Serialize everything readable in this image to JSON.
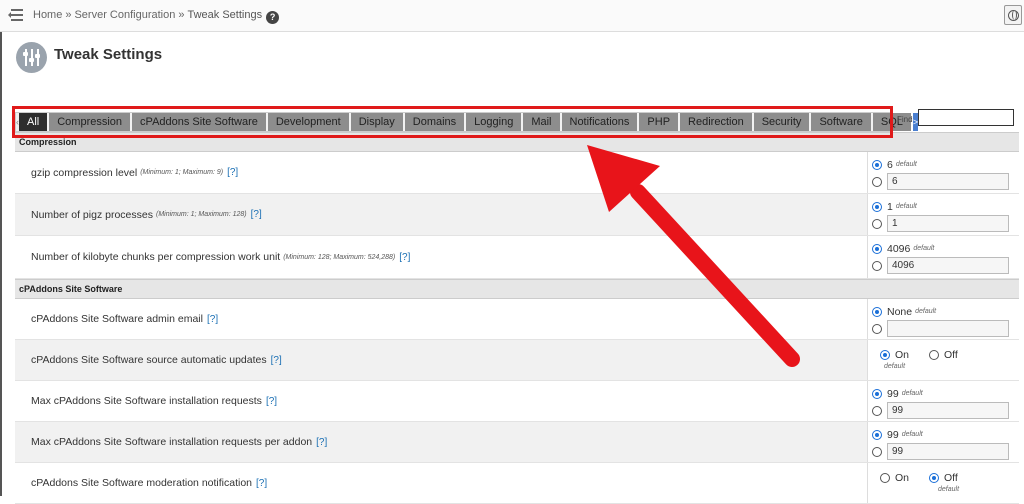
{
  "breadcrumb": {
    "home": "Home",
    "sep": "»",
    "section": "Server Configuration",
    "current": "Tweak Settings",
    "help": "?"
  },
  "page": {
    "title": "Tweak Settings"
  },
  "tabs": {
    "items": [
      "All",
      "Compression",
      "cPAddons Site Software",
      "Development",
      "Display",
      "Domains",
      "Logging",
      "Mail",
      "Notifications",
      "PHP",
      "Redirection",
      "Security",
      "Software",
      "SQL"
    ],
    "active": "All",
    "prev": "‹",
    "next": ">"
  },
  "find": {
    "label": "Find",
    "value": ""
  },
  "sections": [
    {
      "title": "Compression",
      "rows": [
        {
          "label": "gzip compression level",
          "hint": "(Minimum: 1; Maximum: 9)",
          "help": "[?]",
          "default_value": "6",
          "default_tag": "default",
          "input_value": "6"
        },
        {
          "label": "Number of pigz processes",
          "hint": "(Minimum: 1; Maximum: 128)",
          "help": "[?]",
          "default_value": "1",
          "default_tag": "default",
          "input_value": "1"
        },
        {
          "label": "Number of kilobyte chunks per compression work unit",
          "hint": "(Minimum: 128; Maximum: 524,288)",
          "help": "[?]",
          "default_value": "4096",
          "default_tag": "default",
          "input_value": "4096"
        }
      ]
    },
    {
      "title": "cPAddons Site Software",
      "rows": [
        {
          "label": "cPAddons Site Software admin email",
          "hint": "",
          "help": "[?]",
          "default_value": "None",
          "default_tag": "default",
          "input_value": ""
        },
        {
          "label": "cPAddons Site Software source automatic updates",
          "hint": "",
          "help": "[?]",
          "on": "On",
          "off": "Off",
          "selected": "on",
          "default_tag": "default"
        },
        {
          "label": "Max cPAddons Site Software installation requests",
          "hint": "",
          "help": "[?]",
          "default_value": "99",
          "default_tag": "default",
          "input_value": "99"
        },
        {
          "label": "Max cPAddons Site Software installation requests per addon",
          "hint": "",
          "help": "[?]",
          "default_value": "99",
          "default_tag": "default",
          "input_value": "99"
        },
        {
          "label": "cPAddons Site Software moderation notification",
          "hint": "",
          "help": "[?]",
          "on": "On",
          "off": "Off",
          "selected": "off",
          "default_tag": "default"
        }
      ]
    }
  ],
  "colors": {
    "highlight": "#e01a1a",
    "active_tab": "#2e2e2e",
    "tab": "#8d8d8d",
    "link": "#1a6fb4",
    "radio": "#1a6fd8"
  }
}
